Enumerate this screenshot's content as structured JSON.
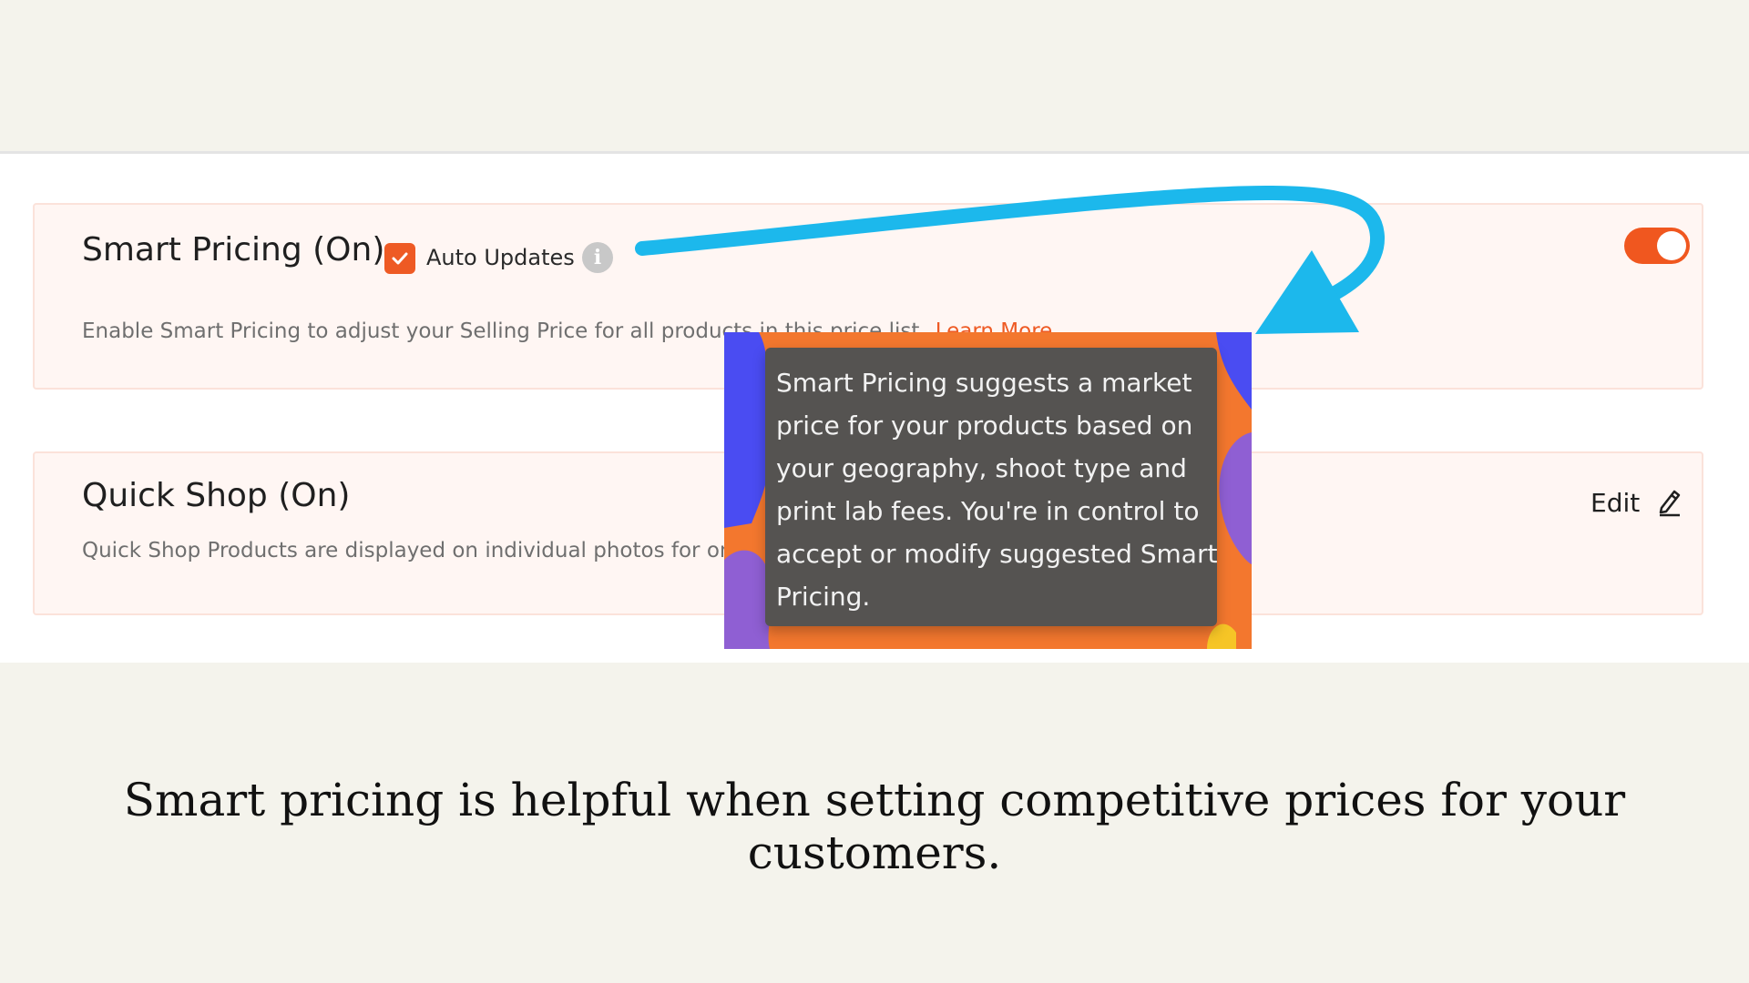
{
  "smart_pricing": {
    "title": "Smart Pricing (On)",
    "auto_updates_label": "Auto Updates",
    "auto_updates_checked": true,
    "info_icon_glyph": "i",
    "description": "Enable Smart Pricing to adjust your Selling Price for all products in this price list.",
    "learn_more": "Learn More",
    "toggle_on": true
  },
  "quick_shop": {
    "title": "Quick Shop (On)",
    "description": "Quick Shop Products are displayed on individual photos for one click adding to cart.",
    "edit_label": "Edit"
  },
  "tooltip": {
    "text": "Smart Pricing suggests a market price for your products based on your geography, shoot type and print lab fees. You're in control to accept or modify suggested Smart Pricing."
  },
  "caption": "Smart pricing is helpful when setting competitive prices for your customers.",
  "colors": {
    "accent": "#ee5a24",
    "arrow": "#1cb8ec",
    "page_background": "#f4f3ec"
  },
  "icons": {
    "checkbox": "check-icon",
    "info": "info-icon",
    "edit": "pencil-icon",
    "annotation": "curved-arrow-icon"
  }
}
